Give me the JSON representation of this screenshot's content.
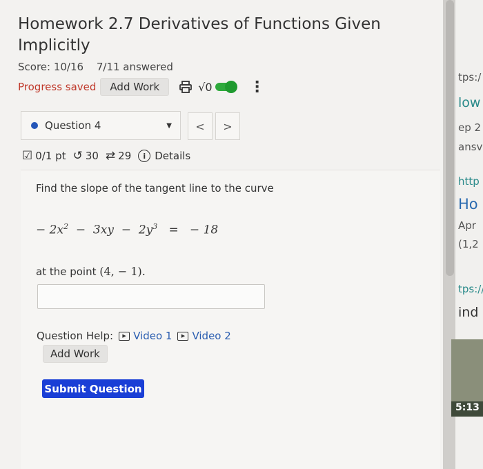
{
  "header": {
    "title": "Homework 2.7 Derivatives of Functions Given Implicitly",
    "score": "Score: 10/16",
    "answered": "7/11 answered",
    "progress_status": "Progress saved",
    "add_work_label": "Add Work",
    "sqrt_symbol": "√0"
  },
  "question_nav": {
    "selected": "Question 4",
    "prev_label": "<",
    "next_label": ">"
  },
  "meta": {
    "points": "0/1 pt",
    "retries": "30",
    "attempts": "29",
    "details_label": "Details"
  },
  "question": {
    "prompt": "Find the slope of the tangent line to the curve",
    "at_point_text": "at the point",
    "point": "(4,  − 1)."
  },
  "help": {
    "label": "Question Help:",
    "video1": "Video 1",
    "video2": "Video 2",
    "add_work_label": "Add Work"
  },
  "submit_label": "Submit Question",
  "side_panel": {
    "fragments": [
      "tps:/",
      "low",
      "ep 2",
      "ansv",
      "http",
      "Ho",
      "Apr",
      "(1,2",
      "tps://",
      "ind"
    ],
    "timestamp": "5:13"
  },
  "colors": {
    "accent_blue": "#1a3fd6",
    "progress_red": "#c0392b",
    "toggle_green": "#2eaa3c"
  }
}
